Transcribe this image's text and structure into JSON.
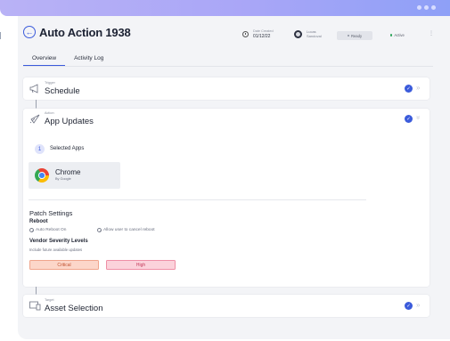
{
  "header": {
    "title": "Auto Action 1938",
    "date_label": "Date Created",
    "date_value": "01/12/22",
    "user_name_line1": "Lucas",
    "user_name_line2": "Sandoval",
    "status_chip": "Ready",
    "status_active": "Active"
  },
  "tabs": [
    {
      "label": "Overview",
      "active": true
    },
    {
      "label": "Activity Log",
      "active": false
    }
  ],
  "steps": {
    "trigger": {
      "label": "Trigger",
      "title": "Schedule"
    },
    "action": {
      "label": "Action",
      "title": "App Updates",
      "selected_apps_number": "1",
      "selected_apps_title": "Selected Apps",
      "app": {
        "name": "Chrome",
        "vendor": "By Google"
      },
      "patch_settings_title": "Patch Settings",
      "reboot_title": "Reboot",
      "reboot_options": [
        "Auto Reboot On",
        "Allow user to cancel reboot"
      ],
      "vendor_title": "Vendor Severity Levels",
      "vendor_sub": "Include future available updates",
      "severities": [
        "Critical",
        "High"
      ]
    },
    "target": {
      "label": "Target",
      "title": "Asset Selection"
    }
  },
  "colors": {
    "accent": "#3b5bdb",
    "critical": "#fcd6c9",
    "high": "#fbd2db",
    "active": "#2fa45b"
  }
}
